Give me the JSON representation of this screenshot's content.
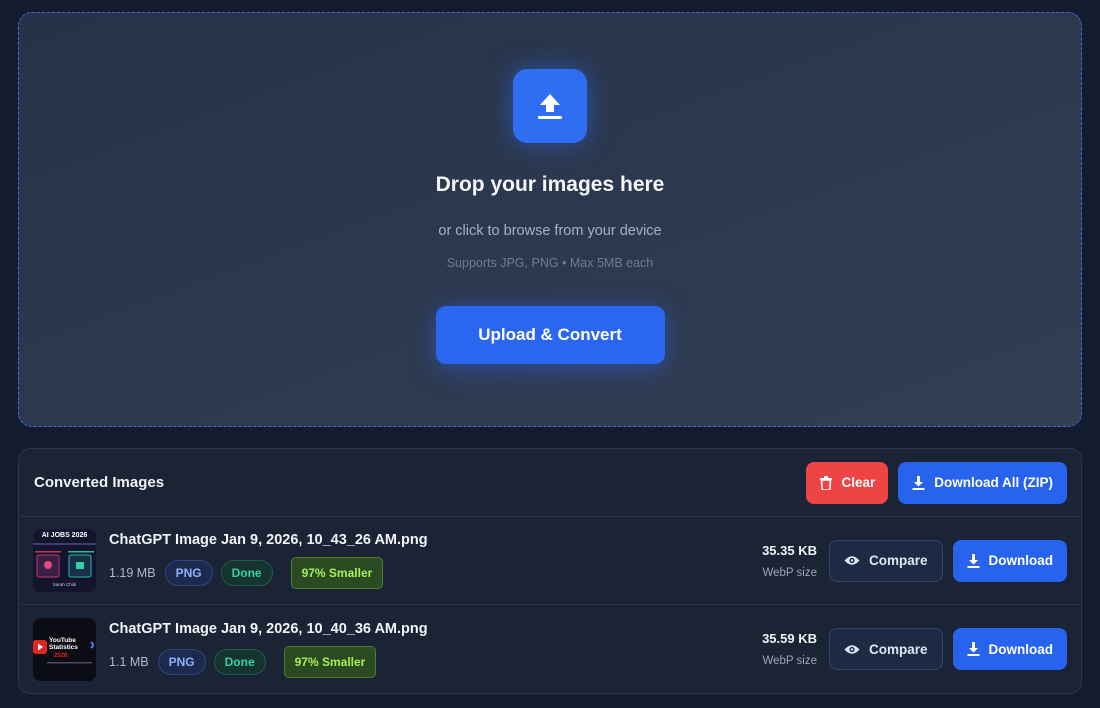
{
  "dropzone": {
    "title": "Drop your images here",
    "subtitle": "or click to browse from your device",
    "hint": "Supports JPG, PNG • Max 5MB each",
    "upload_button": "Upload & Convert",
    "icon": "upload-icon"
  },
  "panel": {
    "title": "Converted Images",
    "clear_label": "Clear",
    "download_all_label": "Download All (ZIP)"
  },
  "files": [
    {
      "name": "ChatGPT Image Jan 9, 2026, 10_43_26 AM.png",
      "original_size": "1.19 MB",
      "format": "PNG",
      "status": "Done",
      "savings": "97% Smaller",
      "webp_size": "35.35 KB",
      "webp_label": "WebP size",
      "compare_label": "Compare",
      "download_label": "Download",
      "thumb_title": "AI JOBS 2026",
      "thumb_caption": "Sarah Chidi"
    },
    {
      "name": "ChatGPT Image Jan 9, 2026, 10_40_36 AM.png",
      "original_size": "1.1 MB",
      "format": "PNG",
      "status": "Done",
      "savings": "97% Smaller",
      "webp_size": "35.59 KB",
      "webp_label": "WebP size",
      "compare_label": "Compare",
      "download_label": "Download",
      "thumb_title": "YouTube Statistics",
      "thumb_year": "2026"
    }
  ],
  "colors": {
    "accent": "#2763ec",
    "danger": "#ef4444",
    "success": "#34d399",
    "savings": "#a6f05a"
  }
}
